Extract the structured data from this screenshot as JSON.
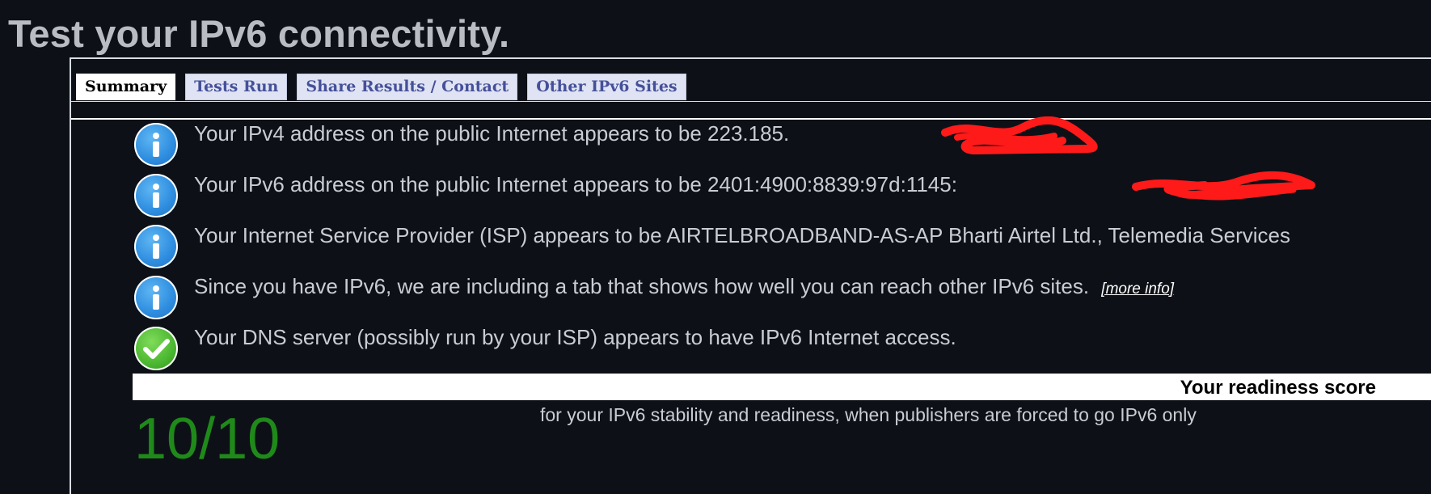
{
  "page": {
    "title": "Test your IPv6 connectivity."
  },
  "tabs": [
    {
      "label": "Summary",
      "active": true
    },
    {
      "label": "Tests Run",
      "active": false
    },
    {
      "label": "Share Results / Contact",
      "active": false
    },
    {
      "label": "Other IPv6 Sites",
      "active": false
    }
  ],
  "summary": {
    "items": [
      {
        "icon": "info-icon",
        "text": "Your IPv4 address on the public Internet appears to be 223.185."
      },
      {
        "icon": "info-icon",
        "text": "Your IPv6 address on the public Internet appears to be 2401:4900:8839:97d:1145:"
      },
      {
        "icon": "info-icon",
        "text": "Your Internet Service Provider (ISP) appears to be AIRTELBROADBAND-AS-AP Bharti Airtel Ltd., Telemedia Services"
      },
      {
        "icon": "info-icon",
        "text": "Since you have IPv6, we are including a tab that shows how well you can reach other IPv6 sites.",
        "link": "[more info]"
      },
      {
        "icon": "checkmark-icon",
        "text": "Your DNS server (possibly run by your ISP) appears to have IPv6 Internet access."
      }
    ]
  },
  "readiness": {
    "title": "Your readiness score",
    "score": "10/10",
    "description": "for your IPv6 stability and readiness, when publishers are forced to go IPv6 only"
  },
  "colors": {
    "background": "#0d1117",
    "text": "#c9cdd3",
    "score_green": "#1f8a1a",
    "tab_inactive_text": "#45509a",
    "redaction": "#ff1a1a"
  }
}
